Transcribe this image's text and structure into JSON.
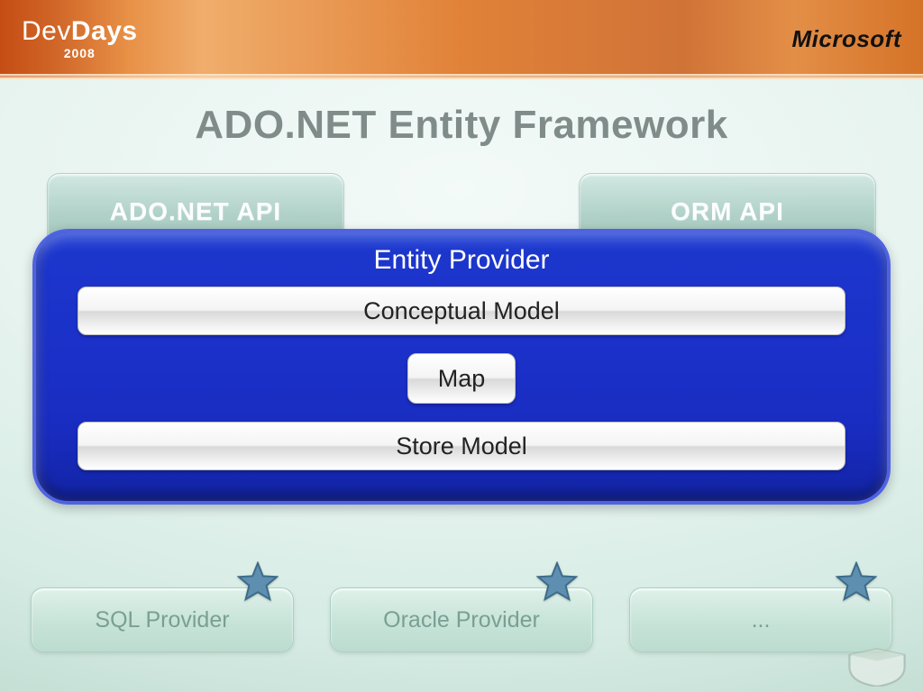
{
  "header": {
    "event_name_light": "Dev",
    "event_name_bold": "Days",
    "event_year": "2008",
    "sponsor": "Microsoft"
  },
  "slide": {
    "title": "ADO.NET Entity Framework",
    "api_left": "ADO.NET API",
    "api_right": "ORM API",
    "panel_title": "Entity Provider",
    "layer_top": "Conceptual Model",
    "layer_mid": "Map",
    "layer_bottom": "Store Model",
    "providers": [
      "SQL Provider",
      "Oracle Provider",
      "..."
    ]
  },
  "colors": {
    "accent_blue": "#1c33c8",
    "star_fill": "#5e8fb0"
  }
}
